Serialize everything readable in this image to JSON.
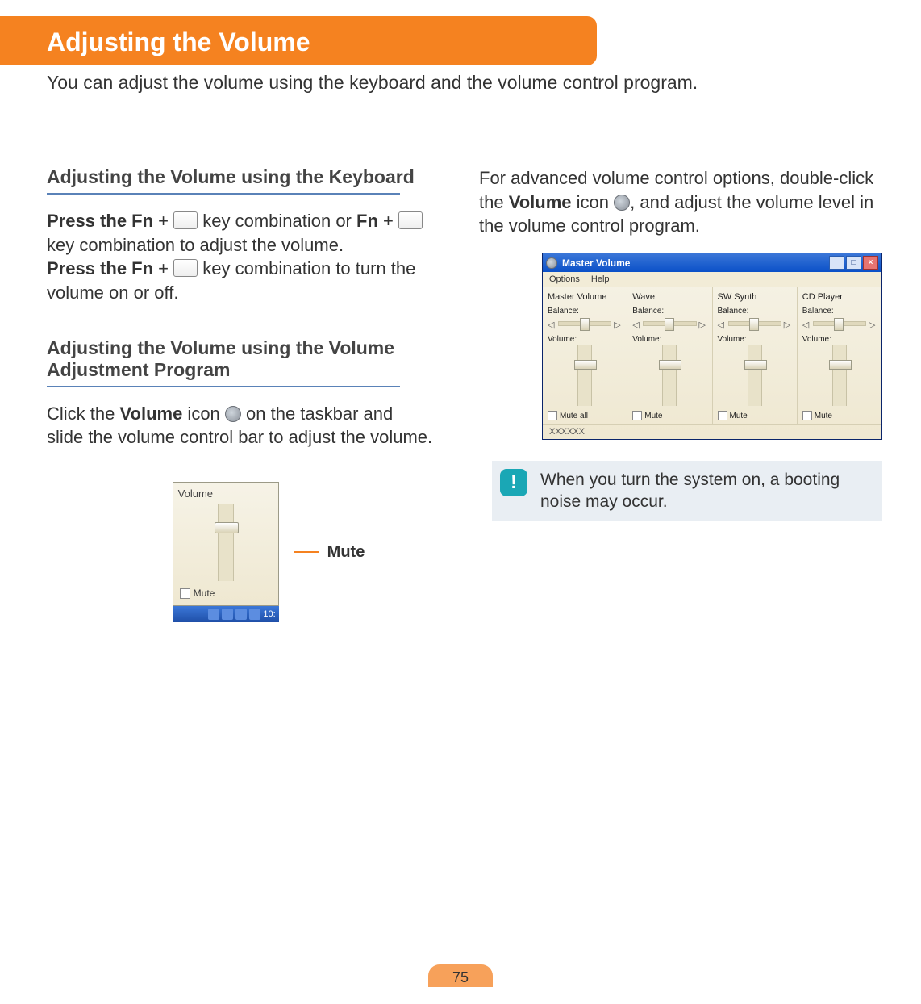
{
  "page": {
    "title": "Adjusting the Volume",
    "intro": "You can adjust the volume using the keyboard and the volume control program.",
    "number": "75"
  },
  "left": {
    "section1_title": "Adjusting the Volume using the Keyboard",
    "s1_p1_a": "Press the Fn",
    "s1_p1_b": " + ",
    "s1_p1_c": " key combination or ",
    "s1_p1_d": "Fn",
    "s1_p1_e": " + ",
    "s1_p1_f": " key combination to adjust the volume.",
    "s1_p2_a": "Press the Fn",
    "s1_p2_b": " + ",
    "s1_p2_c": " key combination to turn the volume on or off.",
    "section2_title": "Adjusting the Volume using the Volume Adjustment Program",
    "s2_p_a": "Click the ",
    "s2_p_b": "Volume",
    "s2_p_c": " icon ",
    "s2_p_d": " on the taskbar and slide the volume control bar to adjust the volume.",
    "popup": {
      "title": "Volume",
      "mute": "Mute",
      "tray_time": "10:"
    },
    "mute_callout": "Mute"
  },
  "right": {
    "p_a": "For advanced volume control options, double-click the ",
    "p_b": "Volume",
    "p_c": " icon ",
    "p_d": ", and adjust the volume level in the volume control program.",
    "window": {
      "title": "Master Volume",
      "menu": {
        "options": "Options",
        "help": "Help"
      },
      "cols": [
        {
          "name": "Master Volume",
          "balance": "Balance:",
          "volume": "Volume:",
          "mute": "Mute all"
        },
        {
          "name": "Wave",
          "balance": "Balance:",
          "volume": "Volume:",
          "mute": "Mute"
        },
        {
          "name": "SW Synth",
          "balance": "Balance:",
          "volume": "Volume:",
          "mute": "Mute"
        },
        {
          "name": "CD Player",
          "balance": "Balance:",
          "volume": "Volume:",
          "mute": "Mute"
        }
      ],
      "footer": "XXXXXX"
    },
    "note": "When you turn the system on, a booting noise may occur."
  }
}
